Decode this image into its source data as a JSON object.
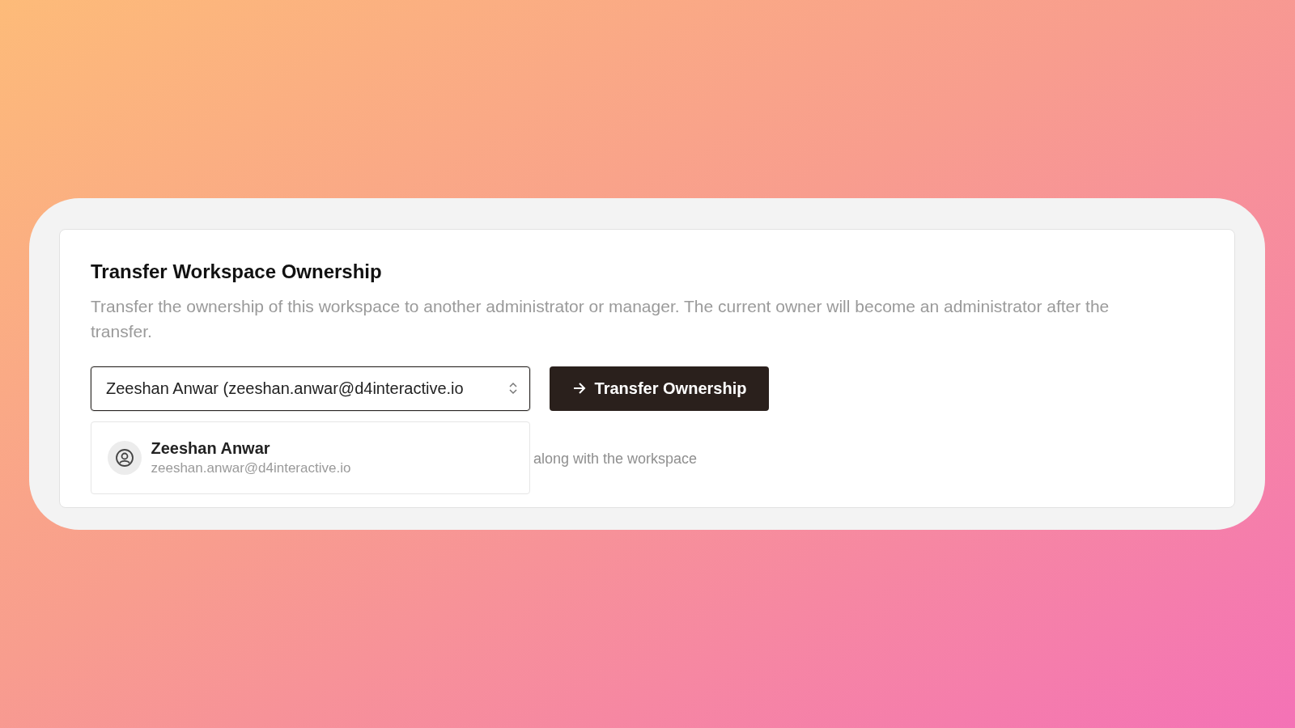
{
  "section": {
    "title": "Transfer Workspace Ownership",
    "description": "Transfer the ownership of this workspace to another administrator or manager. The current owner will become an administrator after the transfer."
  },
  "member_select": {
    "value": "Zeeshan Anwar (zeeshan.anwar@d4interactive.io",
    "expanded": true
  },
  "transfer_button": {
    "label": "Transfer Ownership"
  },
  "options": [
    {
      "name": "Zeeshan Anwar",
      "email": "zeeshan.anwar@d4interactive.io"
    }
  ],
  "note": "along with the workspace"
}
